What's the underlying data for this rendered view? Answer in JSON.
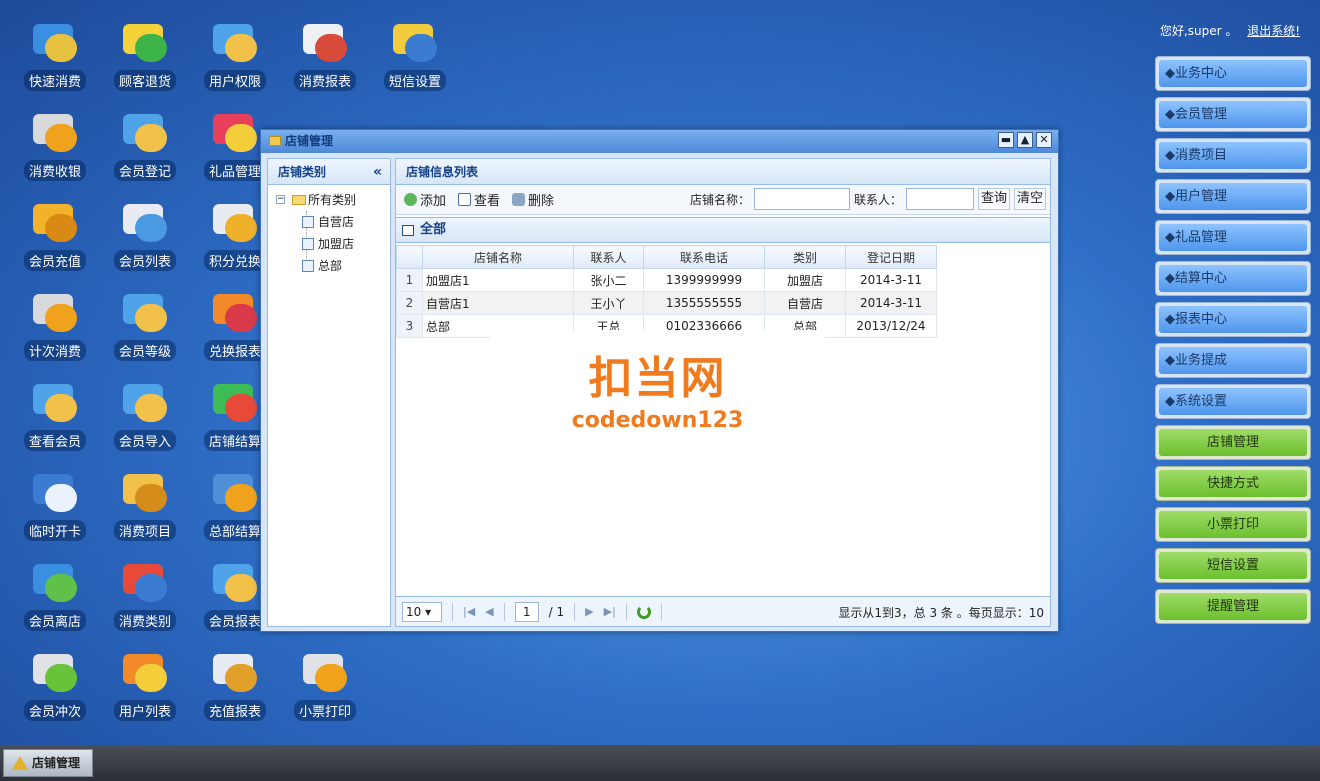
{
  "header": {
    "greeting": "您好,super 。",
    "logout": "退出系统!"
  },
  "desktop_icons": [
    {
      "label": "快速消费",
      "c1": "#3b8fe0",
      "c2": "#e7c240"
    },
    {
      "label": "顾客退货",
      "c1": "#f4d23a",
      "c2": "#3db34a"
    },
    {
      "label": "用户权限",
      "c1": "#4fa3e8",
      "c2": "#f2c14a"
    },
    {
      "label": "消费报表",
      "c1": "#eef0f3",
      "c2": "#d84a3a"
    },
    {
      "label": "短信设置",
      "c1": "#f2cc3c",
      "c2": "#3b7bd2"
    },
    {
      "label": "消费收银",
      "c1": "#d7d9dc",
      "c2": "#f0a21c"
    },
    {
      "label": "会员登记",
      "c1": "#4fa3e8",
      "c2": "#f2c14a"
    },
    {
      "label": "礼品管理",
      "c1": "#e8405a",
      "c2": "#f4cd3b"
    },
    {
      "label": "会员充值",
      "c1": "#f3b22c",
      "c2": "#d98a14"
    },
    {
      "label": "会员列表",
      "c1": "#e8ecf2",
      "c2": "#4a9ae2"
    },
    {
      "label": "积分兑换",
      "c1": "#e8ecf2",
      "c2": "#f0b12a"
    },
    {
      "label": "计次消费",
      "c1": "#d7d9dc",
      "c2": "#f0a21c"
    },
    {
      "label": "会员等级",
      "c1": "#4fa3e8",
      "c2": "#f2c14a"
    },
    {
      "label": "兑换报表",
      "c1": "#f28a2a",
      "c2": "#d93a4a"
    },
    {
      "label": "查看会员",
      "c1": "#4fa3e8",
      "c2": "#f2c14a"
    },
    {
      "label": "会员导入",
      "c1": "#4fa3e8",
      "c2": "#f2c14a"
    },
    {
      "label": "店铺结算",
      "c1": "#3dbb55",
      "c2": "#e84a3a"
    },
    {
      "label": "临时开卡",
      "c1": "#3b7bd2",
      "c2": "#eaf2fc"
    },
    {
      "label": "消费项目",
      "c1": "#f2c14a",
      "c2": "#d68c1a"
    },
    {
      "label": "总部结算",
      "c1": "#4f8fd8",
      "c2": "#f0a21c"
    },
    {
      "label": "会员离店",
      "c1": "#3b8fe0",
      "c2": "#5fc14a"
    },
    {
      "label": "消费类别",
      "c1": "#e84a3a",
      "c2": "#3b7bd2"
    },
    {
      "label": "会员报表",
      "c1": "#4fa3e8",
      "c2": "#f2c14a"
    },
    {
      "label": "会员冲次",
      "c1": "#e0e2e5",
      "c2": "#6ac23a"
    },
    {
      "label": "用户列表",
      "c1": "#f28a2a",
      "c2": "#f4cd3b"
    },
    {
      "label": "充值报表",
      "c1": "#e8ecf2",
      "c2": "#e0a02a"
    },
    {
      "label": "小票打印",
      "c1": "#e0e2e5",
      "c2": "#f0a21c"
    }
  ],
  "nav_menu": [
    "◆业务中心",
    "◆会员管理",
    "◆消费项目",
    "◆用户管理",
    "◆礼品管理",
    "◆结算中心",
    "◆报表中心",
    "◆业务提成",
    "◆系统设置"
  ],
  "quick_buttons": [
    "店铺管理",
    "快捷方式",
    "小票打印",
    "短信设置",
    "提醒管理"
  ],
  "window": {
    "title": "店铺管理",
    "btn_min": "▬",
    "btn_max": "▲",
    "btn_close": "✕"
  },
  "left_panel": {
    "title": "店铺类别",
    "collapse": "«",
    "tree_root": "所有类别",
    "tree_expand": "−",
    "tree_children": [
      "自营店",
      "加盟店",
      "总部"
    ]
  },
  "main_panel": {
    "title": "店铺信息列表",
    "grid_title": "全部"
  },
  "toolbar": {
    "add": "添加",
    "view": "查看",
    "delete": "删除",
    "store_name_label": "店铺名称：",
    "store_name_value": "",
    "contact_label": "联系人：",
    "contact_value": "",
    "query": "查询",
    "clear": "清空"
  },
  "table": {
    "columns": [
      "店铺名称",
      "联系人",
      "联系电话",
      "类别",
      "登记日期"
    ],
    "rows": [
      {
        "n": "1",
        "name": "加盟店1",
        "contact": "张小二",
        "phone": "1399999999",
        "type": "加盟店",
        "date": "2014-3-11"
      },
      {
        "n": "2",
        "name": "自营店1",
        "contact": "王小丫",
        "phone": "1355555555",
        "type": "自营店",
        "date": "2014-3-11"
      },
      {
        "n": "3",
        "name": "总部",
        "contact": "王总",
        "phone": "0102336666",
        "type": "总部",
        "date": "2013/12/24"
      }
    ]
  },
  "pager": {
    "page_size": "10",
    "page": "1",
    "total_pages": "/ 1",
    "info": "显示从1到3，总 3 条 。每页显示：10"
  },
  "watermark": {
    "line1": "扣当网",
    "line2": "codedown123"
  },
  "taskbar": {
    "item": "店铺管理"
  }
}
